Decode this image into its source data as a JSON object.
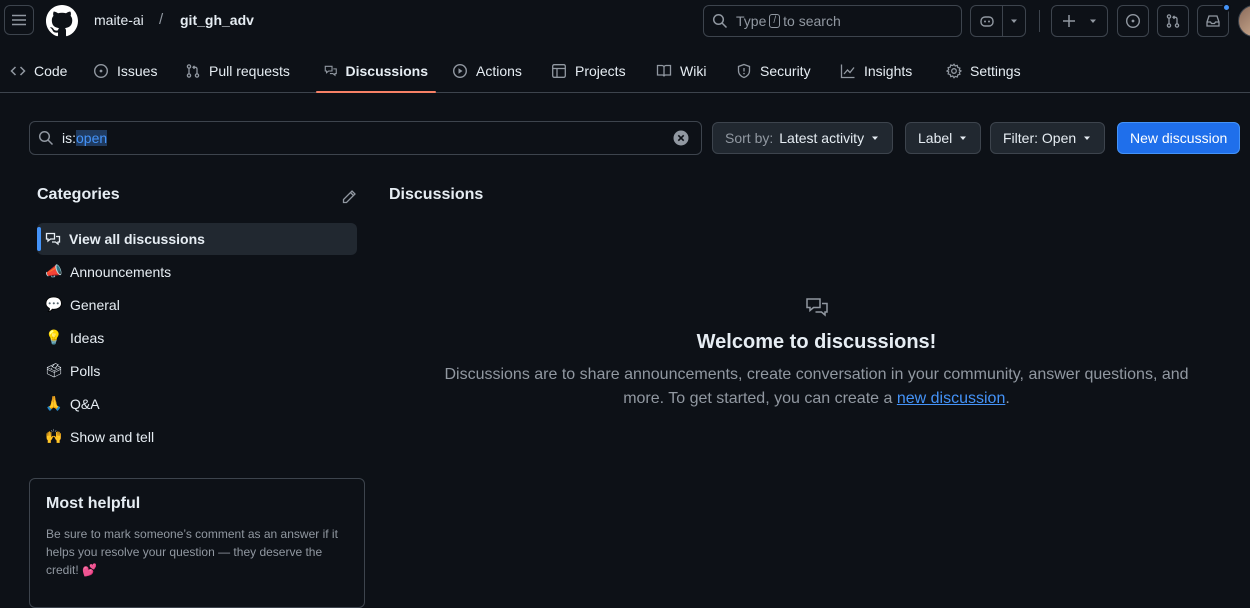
{
  "header": {
    "owner": "maite-ai",
    "separator": "/",
    "repo": "git_gh_adv",
    "search_prefix": "Type",
    "search_key": "/",
    "search_suffix": "to search"
  },
  "nav": {
    "tabs": [
      {
        "label": "Code",
        "icon": "code-icon"
      },
      {
        "label": "Issues",
        "icon": "issue-opened-icon"
      },
      {
        "label": "Pull requests",
        "icon": "git-pull-request-icon"
      },
      {
        "label": "Discussions",
        "icon": "comment-discussion-icon",
        "active": true
      },
      {
        "label": "Actions",
        "icon": "play-icon"
      },
      {
        "label": "Projects",
        "icon": "table-icon"
      },
      {
        "label": "Wiki",
        "icon": "book-icon"
      },
      {
        "label": "Security",
        "icon": "shield-icon"
      },
      {
        "label": "Insights",
        "icon": "graph-icon"
      },
      {
        "label": "Settings",
        "icon": "gear-icon"
      }
    ]
  },
  "filter": {
    "query_key": "is:",
    "query_value": "open",
    "sort_prefix": "Sort by:",
    "sort_value": "Latest activity",
    "label_button": "Label",
    "filter_button": "Filter: Open",
    "new_discussion": "New discussion"
  },
  "sidebar": {
    "title": "Categories",
    "items": [
      {
        "label": "View all discussions",
        "icon": "comment-discussion-icon",
        "active": true
      },
      {
        "label": "Announcements",
        "emoji": "📣"
      },
      {
        "label": "General",
        "emoji": "💬"
      },
      {
        "label": "Ideas",
        "emoji": "💡"
      },
      {
        "label": "Polls",
        "emoji": "🗳"
      },
      {
        "label": "Q&A",
        "emoji": "🙏"
      },
      {
        "label": "Show and tell",
        "emoji": "🙌"
      }
    ],
    "helpful_title": "Most helpful",
    "helpful_text": "Be sure to mark someone’s comment as an answer if it helps you resolve your question — they deserve the credit! 💕"
  },
  "main": {
    "title": "Discussions",
    "empty_title": "Welcome to discussions!",
    "empty_text_1": "Discussions are to share announcements, create conversation in your community, answer questions, and more. To get started, you can create a",
    "empty_link": "new discussion",
    "empty_text_2": "."
  },
  "colors": {
    "background": "#0d1117",
    "border": "#3d444d",
    "accent_blue": "#4493f8",
    "primary_button": "#1f6feb",
    "active_tab_underline": "#f78166"
  }
}
